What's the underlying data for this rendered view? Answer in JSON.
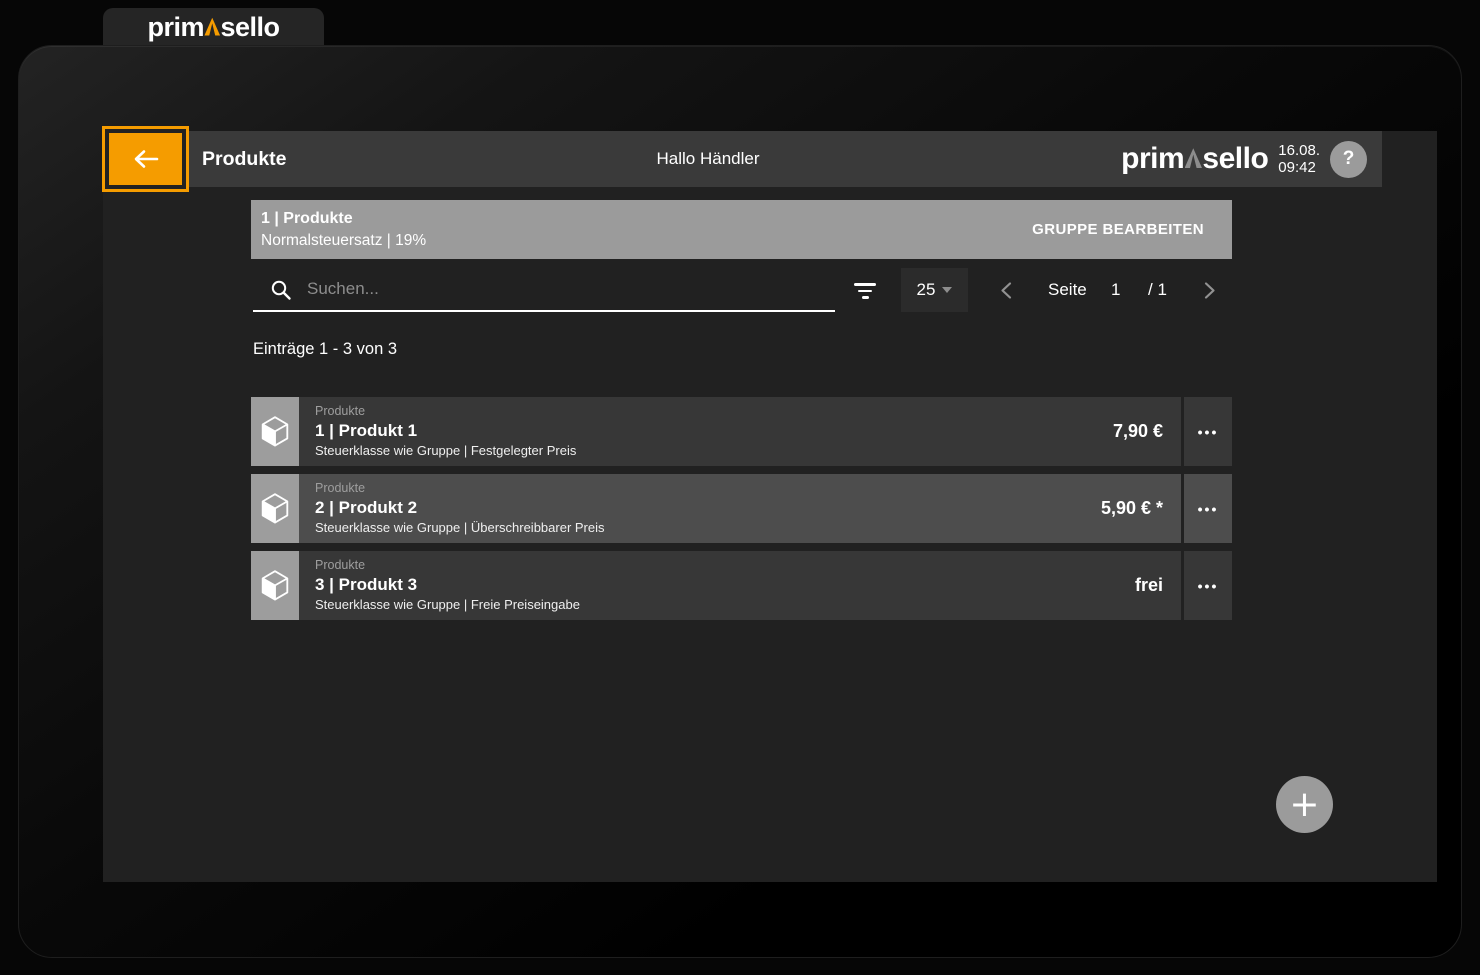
{
  "brand": {
    "prefix": "prim",
    "caret_glyph": "Λ",
    "suffix": "sello",
    "accent_color": "#f59c00"
  },
  "header": {
    "title": "Produkte",
    "greeting": "Hallo Händler",
    "date": "16.08.",
    "time": "09:42",
    "help_label": "?"
  },
  "group_bar": {
    "title": "1 | Produkte",
    "subtitle": "Normalsteuersatz | 19%",
    "action_label": "GRUPPE BEARBEITEN"
  },
  "toolbar": {
    "search_placeholder": "Suchen...",
    "page_size": "25",
    "pagination": {
      "label": "Seite",
      "current": "1",
      "total": "/ 1"
    }
  },
  "entries_summary": "Einträge 1 - 3 von 3",
  "products": [
    {
      "category": "Produkte",
      "title": "1 | Produkt 1",
      "details": "Steuerklasse wie Gruppe | Festgelegter Preis",
      "price": "7,90 €",
      "highlighted": false
    },
    {
      "category": "Produkte",
      "title": "2 | Produkt 2",
      "details": "Steuerklasse wie Gruppe | Überschreibbarer Preis",
      "price": "5,90 € *",
      "highlighted": true
    },
    {
      "category": "Produkte",
      "title": "3 | Produkt 3",
      "details": "Steuerklasse wie Gruppe | Freie Preiseingabe",
      "price": "frei",
      "highlighted": false
    }
  ],
  "glyphs": {
    "more": "•••",
    "add": "+"
  },
  "icons": {
    "back": "arrow-left",
    "search": "magnifier",
    "filter": "filter-lines",
    "page_size": "triangle-down",
    "prev": "chevron-left",
    "next": "chevron-right",
    "product": "cube-package",
    "more": "ellipsis",
    "add": "plus",
    "help": "question-mark"
  }
}
